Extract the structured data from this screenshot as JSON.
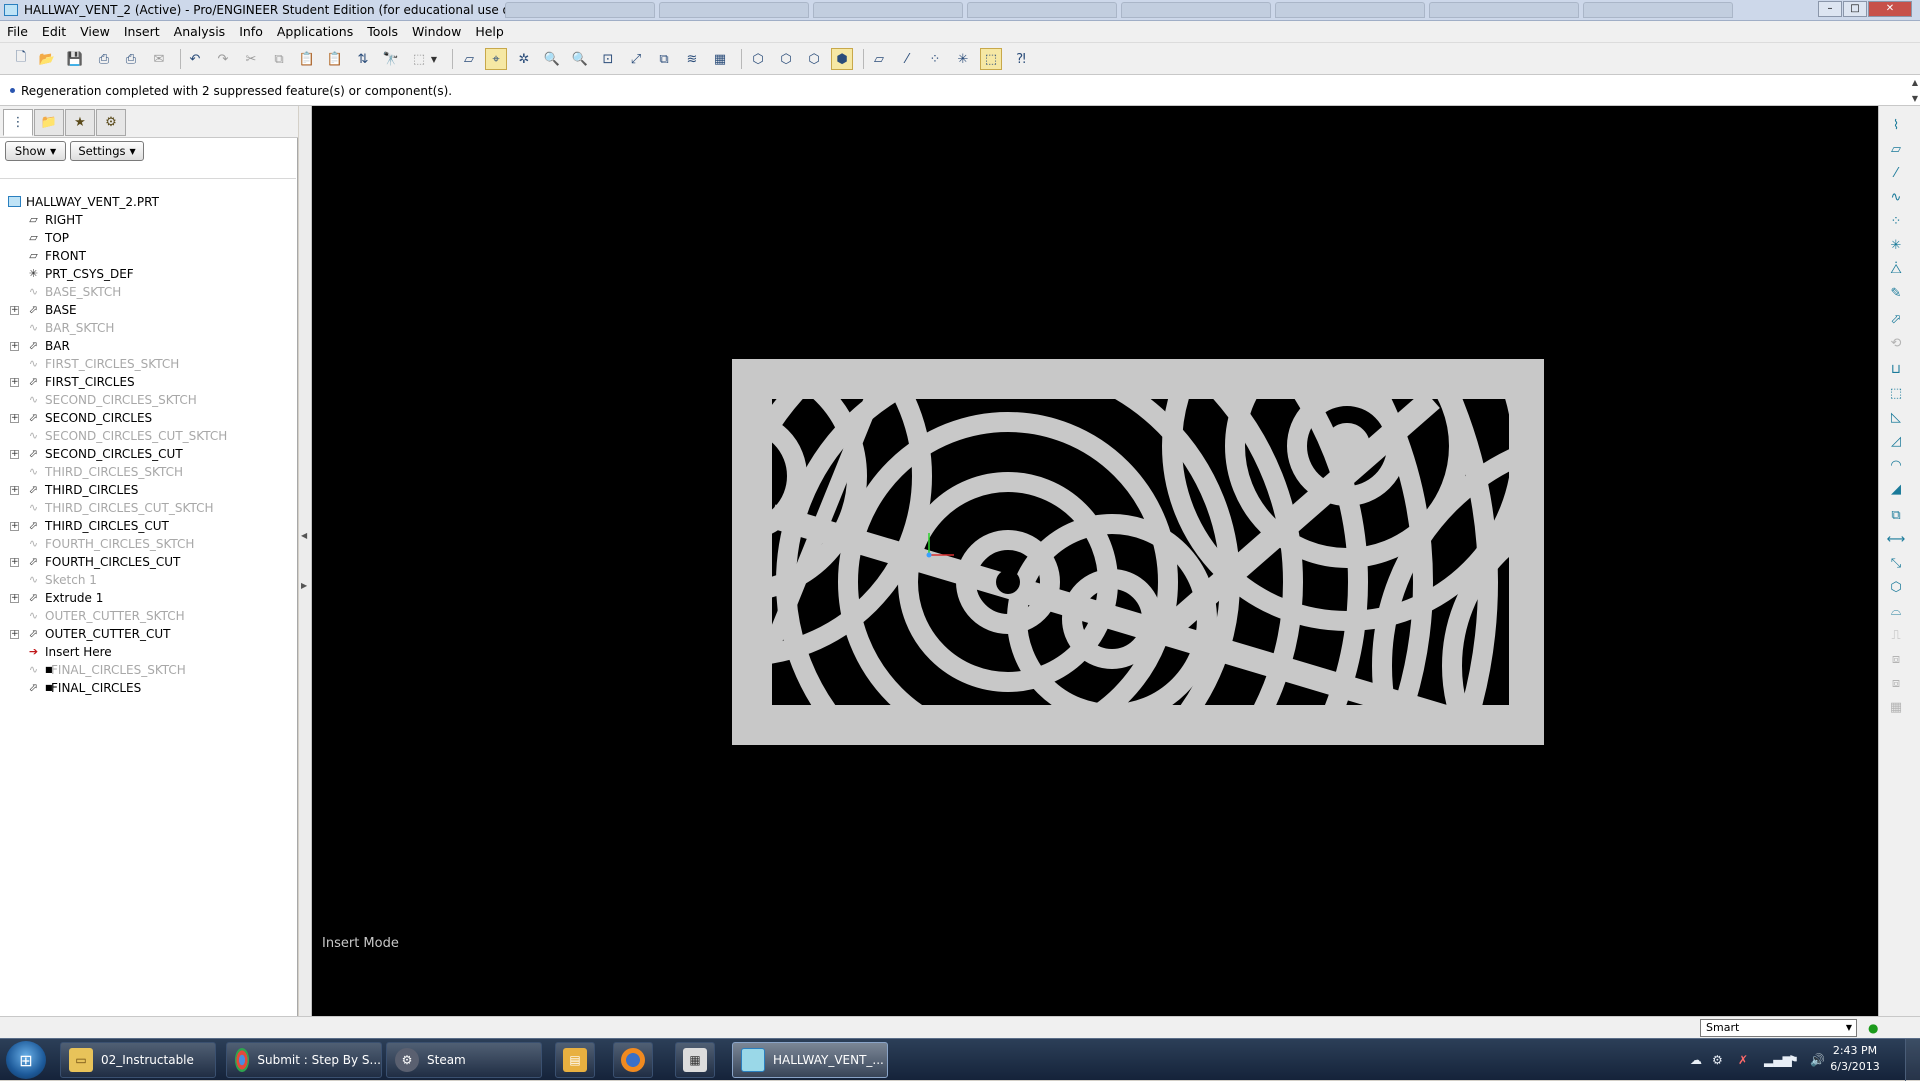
{
  "window": {
    "title": "HALLWAY_VENT_2 (Active) - Pro/ENGINEER Student Edition (for educational use only)",
    "controls": {
      "minimize": "–",
      "maximize": "□",
      "close": "✕"
    }
  },
  "menu": [
    "File",
    "Edit",
    "View",
    "Insert",
    "Analysis",
    "Info",
    "Applications",
    "Tools",
    "Window",
    "Help"
  ],
  "message": "Regeneration completed with 2 suppressed feature(s) or component(s).",
  "panel": {
    "show_label": "Show",
    "settings_label": "Settings"
  },
  "tree": {
    "root": "HALLWAY_VENT_2.PRT",
    "items": [
      {
        "label": "RIGHT",
        "icon": "datum-plane-icon",
        "state": "normal"
      },
      {
        "label": "TOP",
        "icon": "datum-plane-icon",
        "state": "normal"
      },
      {
        "label": "FRONT",
        "icon": "datum-plane-icon",
        "state": "normal"
      },
      {
        "label": "PRT_CSYS_DEF",
        "icon": "csys-icon",
        "state": "normal"
      },
      {
        "label": "BASE_SKTCH",
        "icon": "sketch-icon",
        "state": "hidden"
      },
      {
        "label": "BASE",
        "icon": "extrude-icon",
        "state": "normal"
      },
      {
        "label": "BAR_SKTCH",
        "icon": "sketch-icon",
        "state": "hidden"
      },
      {
        "label": "BAR",
        "icon": "extrude-icon",
        "state": "normal"
      },
      {
        "label": "FIRST_CIRCLES_SKTCH",
        "icon": "sketch-icon",
        "state": "hidden"
      },
      {
        "label": "FIRST_CIRCLES",
        "icon": "extrude-icon",
        "state": "normal"
      },
      {
        "label": "SECOND_CIRCLES_SKTCH",
        "icon": "sketch-icon",
        "state": "hidden"
      },
      {
        "label": "SECOND_CIRCLES",
        "icon": "extrude-icon",
        "state": "normal"
      },
      {
        "label": "SECOND_CIRCLES_CUT_SKTCH",
        "icon": "sketch-icon",
        "state": "hidden"
      },
      {
        "label": "SECOND_CIRCLES_CUT",
        "icon": "extrude-icon",
        "state": "normal"
      },
      {
        "label": "THIRD_CIRCLES_SKTCH",
        "icon": "sketch-icon",
        "state": "hidden"
      },
      {
        "label": "THIRD_CIRCLES",
        "icon": "extrude-icon",
        "state": "normal"
      },
      {
        "label": "THIRD_CIRCLES_CUT_SKTCH",
        "icon": "sketch-icon",
        "state": "hidden"
      },
      {
        "label": "THIRD_CIRCLES_CUT",
        "icon": "extrude-icon",
        "state": "normal"
      },
      {
        "label": "FOURTH_CIRCLES_SKTCH",
        "icon": "sketch-icon",
        "state": "hidden"
      },
      {
        "label": "FOURTH_CIRCLES_CUT",
        "icon": "extrude-icon",
        "state": "normal"
      },
      {
        "label": "Sketch 1",
        "icon": "sketch-icon",
        "state": "hidden"
      },
      {
        "label": "Extrude 1",
        "icon": "extrude-icon",
        "state": "normal"
      },
      {
        "label": "OUTER_CUTTER_SKTCH",
        "icon": "sketch-icon",
        "state": "hidden"
      },
      {
        "label": "OUTER_CUTTER_CUT",
        "icon": "extrude-icon",
        "state": "normal"
      },
      {
        "label": "Insert Here",
        "icon": "insert-arrow-icon",
        "state": "insert"
      },
      {
        "label": "FINAL_CIRCLES_SKTCH",
        "icon": "sketch-icon",
        "state": "suppressed"
      },
      {
        "label": "FINAL_CIRCLES",
        "icon": "extrude-icon",
        "state": "suppressed-active"
      }
    ]
  },
  "viewport": {
    "mode": "Insert Mode",
    "background": "#000000",
    "part_color": "#c8c8c8"
  },
  "status": {
    "filter": "Smart"
  },
  "taskbar": {
    "items": [
      {
        "label": "02_Instructable",
        "icon": "folder-icon"
      },
      {
        "label": "Submit : Step By S...",
        "icon": "chrome-icon"
      },
      {
        "label": "Steam",
        "icon": "steam-icon"
      },
      {
        "label": "",
        "icon": "archive-icon"
      },
      {
        "label": "",
        "icon": "firefox-icon"
      },
      {
        "label": "",
        "icon": "utility-icon"
      },
      {
        "label": "HALLWAY_VENT_...",
        "icon": "proe-icon"
      }
    ],
    "time": "2:43 PM",
    "date": "6/3/2013"
  }
}
